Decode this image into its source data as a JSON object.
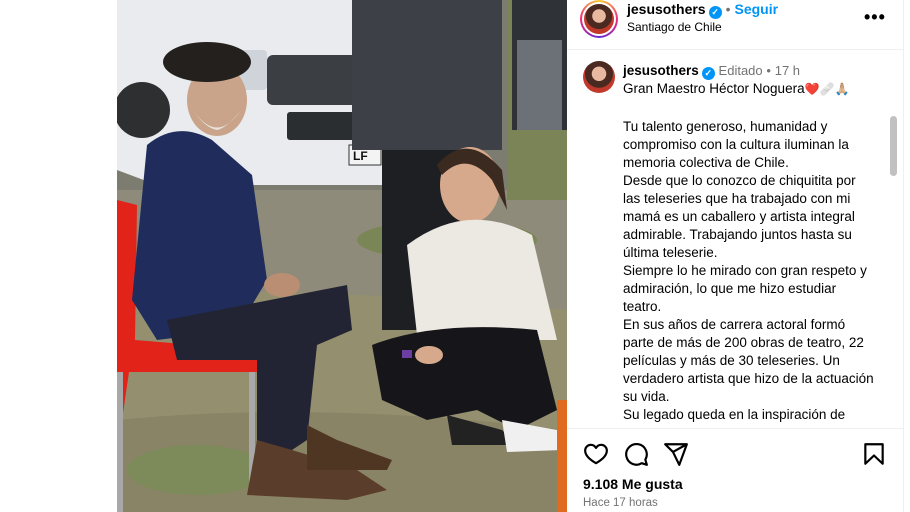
{
  "header": {
    "username": "jesusothers",
    "follow_label": "Seguir",
    "location": "Santiago de Chile",
    "more_label": "•••"
  },
  "caption": {
    "username": "jesusothers",
    "edited": "Editado",
    "time_ago": "17 h",
    "first_line": "Gran Maestro Héctor Noguera",
    "emojis": "❤️🩹🙏🏼",
    "body": "Tu talento generoso, humanidad y compromiso con la cultura iluminan la memoria colectiva de Chile.\nDesde que lo conozco de chiquitita por las teleseries que ha trabajado con mi mamá es un caballero y artista integral admirable. Trabajando juntos hasta su última teleserie.\nSiempre lo he mirado con gran respeto y admiración, lo que me hizo estudiar teatro.\nEn sus años de carrera actoral formó parte de más de 200 obras de teatro, 22 películas y más de 30 teleseries. Un verdadero artista que hizo de la actuación su vida.\nSu legado queda en la inspiración de"
  },
  "actions": {
    "likes": "9.108 Me gusta",
    "posted": "Hace 17 horas"
  },
  "colors": {
    "accent": "#0095f6",
    "muted": "#737373"
  }
}
